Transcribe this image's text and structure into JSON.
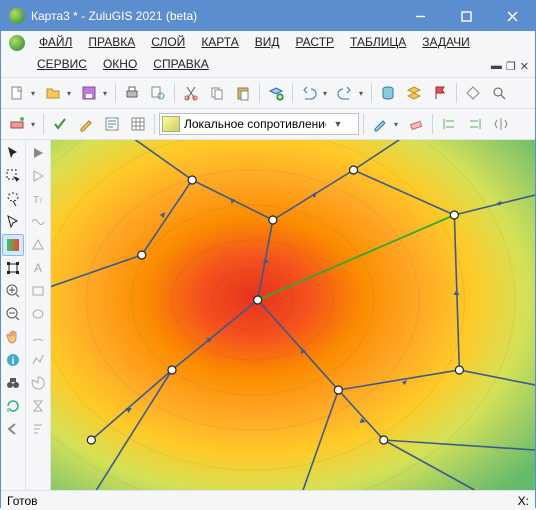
{
  "title": "Карта3 * - ZuluGIS 2021 (beta)",
  "menu": {
    "file": "ФАЙЛ",
    "edit": "ПРАВКА",
    "layer": "СЛОЙ",
    "map": "КАРТА",
    "view": "ВИД",
    "raster": "РАСТР",
    "table": "ТАБЛИЦА",
    "tasks": "ЗАДАЧИ",
    "service": "СЕРВИС",
    "window": "ОКНО",
    "help": "СПРАВКА"
  },
  "combo": {
    "value": "Локальное сопротивление"
  },
  "status": {
    "ready": "Готов",
    "coord": "X:"
  }
}
